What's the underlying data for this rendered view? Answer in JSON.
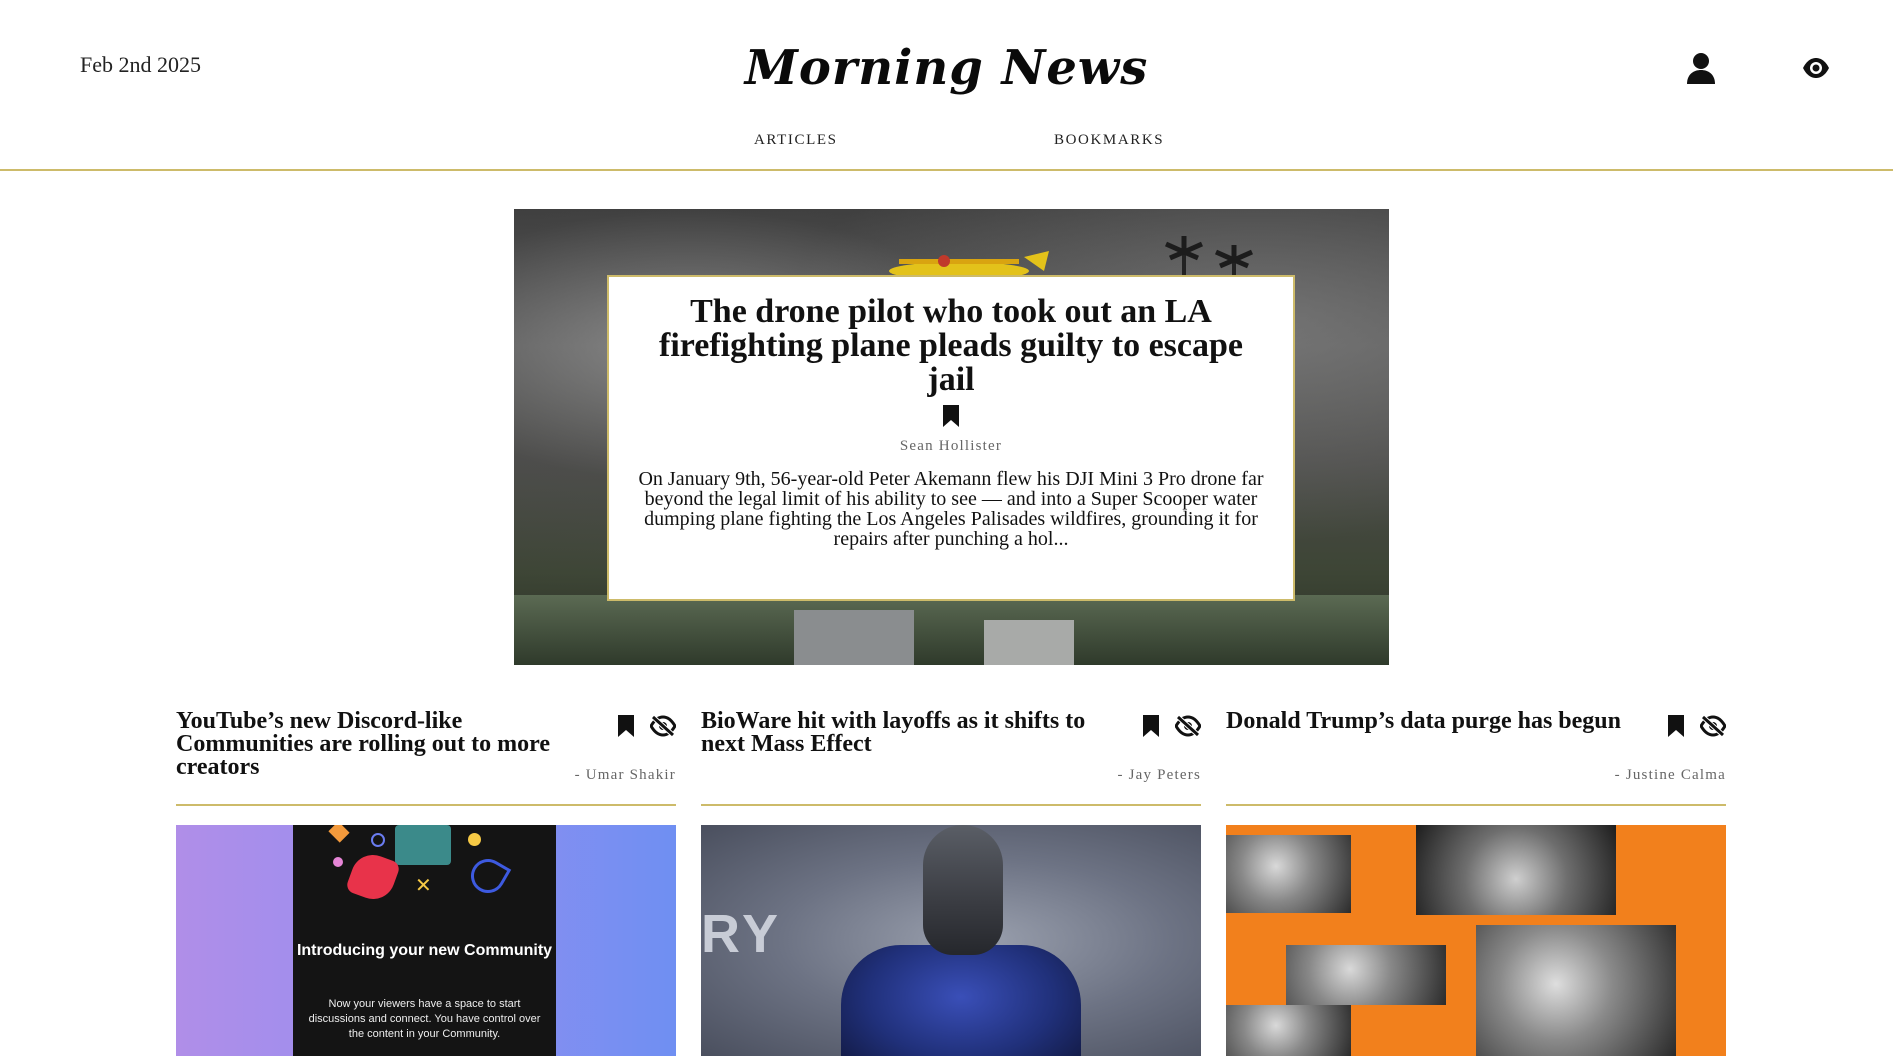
{
  "header": {
    "date": "Feb 2nd 2025",
    "logo": "Morning News",
    "nav": {
      "articles": "ARTICLES",
      "bookmarks": "BOOKMARKS"
    },
    "icons": {
      "user": "user-icon",
      "view": "eye-icon"
    }
  },
  "hero": {
    "title": "The drone pilot who took out an LA firefighting plane pleads guilty to escape jail",
    "author": "Sean Hollister",
    "summary": "On January 9th, 56-year-old Peter Akemann flew his DJI Mini 3 Pro drone far beyond the legal limit of his ability to see — and into a Super Scooper water dumping plane fighting the Los Angeles Palisades wildfires, grounding it for repairs after punching a hol...",
    "icons": {
      "bookmark": "bookmark-icon"
    }
  },
  "articles": [
    {
      "title": "YouTube’s new Discord-like Communities are rolling out to more creators",
      "author": "- Umar Shakir",
      "image": {
        "heading": "Introducing your new Community",
        "body": "Now your viewers have a space to start discussions and connect. You have control over the content in your Community."
      }
    },
    {
      "title": "BioWare hit with layoffs as it shifts to next Mass Effect",
      "author": "- Jay Peters",
      "image": {
        "text": "RY"
      }
    },
    {
      "title": "Donald Trump’s data purge has begun",
      "author": "- Justine Calma",
      "image": {}
    }
  ],
  "colors": {
    "accent": "#cdbb6a",
    "text": "#111111",
    "muted": "#666666"
  }
}
